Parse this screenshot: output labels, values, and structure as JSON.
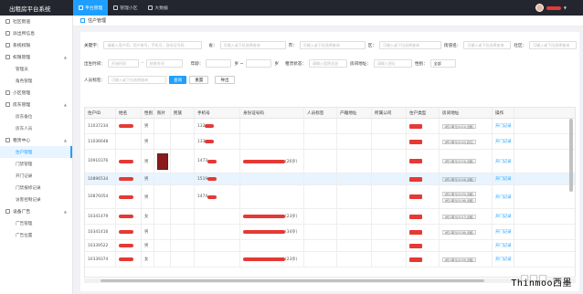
{
  "app": {
    "title": "出租房平台系统"
  },
  "topnav": [
    {
      "label": "平台管理",
      "active": true
    },
    {
      "label": "管理小区",
      "active": false
    },
    {
      "label": "大数据",
      "active": false
    }
  ],
  "sidebar": [
    {
      "label": "社区街道",
      "type": "item"
    },
    {
      "label": "派出所信息",
      "type": "item"
    },
    {
      "label": "系统权限",
      "type": "item"
    },
    {
      "label": "权限管理",
      "type": "item",
      "expandable": true
    },
    {
      "label": "管理员",
      "type": "sub"
    },
    {
      "label": "角色管理",
      "type": "sub"
    },
    {
      "label": "小区管理",
      "type": "item"
    },
    {
      "label": "房东管理",
      "type": "item",
      "expandable": true
    },
    {
      "label": "房东备位",
      "type": "sub"
    },
    {
      "label": "房东人员",
      "type": "sub"
    },
    {
      "label": "租赁中心",
      "type": "item",
      "expandable": true
    },
    {
      "label": "住户管理",
      "type": "sub",
      "active": true
    },
    {
      "label": "门禁管理",
      "type": "sub"
    },
    {
      "label": "开门记录",
      "type": "sub"
    },
    {
      "label": "门禁报修记录",
      "type": "sub"
    },
    {
      "label": "访客控制记录",
      "type": "sub"
    },
    {
      "label": "设备广告",
      "type": "item",
      "expandable": true
    },
    {
      "label": "广告管理",
      "type": "sub"
    },
    {
      "label": "广告位置",
      "type": "sub"
    }
  ],
  "breadcrumb": "住户管理",
  "filters": {
    "keyword_label": "关键字：",
    "keyword_placeholder": "请输入用户ID，用户账号，手机号，身份证号码",
    "province_label": "省：",
    "city_label": "市：",
    "district_label": "区：",
    "street_label": "街道名：",
    "community_label": "社区：",
    "select_placeholder": "可输入或下拉选择查询",
    "birth_label": "出生时间：",
    "start_placeholder": "开始时间",
    "end_placeholder": "结束时间",
    "age_label": "年龄：",
    "age_sep": "岁 ~",
    "age_unit": "岁",
    "housing_label": "租赁状态：",
    "housing_placeholder": "请输入租赁状态",
    "native_label": "房间地址：",
    "native_placeholder": "请输入地址",
    "gender_label": "性别：",
    "gender_value": "全部",
    "type_label": "人员标签：",
    "search_button": "查询",
    "reset_button": "重置",
    "export_button": "导出"
  },
  "table": {
    "headers": [
      "住户ID",
      "姓名",
      "性别",
      "照片",
      "民族",
      "手机号",
      "身份证号码",
      "人员标签",
      "户籍地址",
      "所属公司",
      "住户类型",
      "房间地址",
      "操作"
    ],
    "rows": [
      {
        "id": "11037234",
        "gender": "男",
        "phone": "132",
        "idsuffix": "",
        "addr": [
          "1栋1单元0101(出租)"
        ],
        "action": "开门记录"
      },
      {
        "id": "11036648",
        "gender": "男",
        "phone": "133",
        "idsuffix": "",
        "addr": [
          "1栋1单元0102(自住)"
        ],
        "action": "开门记录"
      },
      {
        "id": "10910376",
        "gender": "男",
        "phone": "1473",
        "idsuffix": "(26岁)",
        "addr": [
          "1栋1单元0103(出租)"
        ],
        "action": "开门记录",
        "photo": true
      },
      {
        "id": "10896534",
        "gender": "男",
        "phone": "1519",
        "idsuffix": "",
        "addr": [
          "1栋1单元0104(出租)"
        ],
        "action": "开门记录",
        "selected": true
      },
      {
        "id": "10876054",
        "gender": "男",
        "phone": "1474",
        "idsuffix": "",
        "addr": [
          "1栋1单元0105(出租)",
          "1栋1单元0106(出租)"
        ],
        "action": "开门记录"
      },
      {
        "id": "10341479",
        "gender": "女",
        "phone": "",
        "idsuffix": "(23岁)",
        "addr": [
          "1栋1单元0107(出租)"
        ],
        "action": "开门记录"
      },
      {
        "id": "10341416",
        "gender": "男",
        "phone": "",
        "idsuffix": "(34岁)",
        "addr": [
          "1栋1单元0108(出租)"
        ],
        "action": "开门记录"
      },
      {
        "id": "10339522",
        "gender": "男",
        "phone": "",
        "idsuffix": "",
        "addr": [],
        "action": "开门记录"
      },
      {
        "id": "10339374",
        "gender": "女",
        "phone": "",
        "idsuffix": "(23岁)",
        "addr": [
          "1栋1单元0109(出租)"
        ],
        "action": "开门记录"
      }
    ]
  },
  "watermark": "Thinmoo西墨",
  "colors": {
    "accent": "#1e9fff",
    "topbar": "#23262e",
    "redaction": "#e53935"
  }
}
